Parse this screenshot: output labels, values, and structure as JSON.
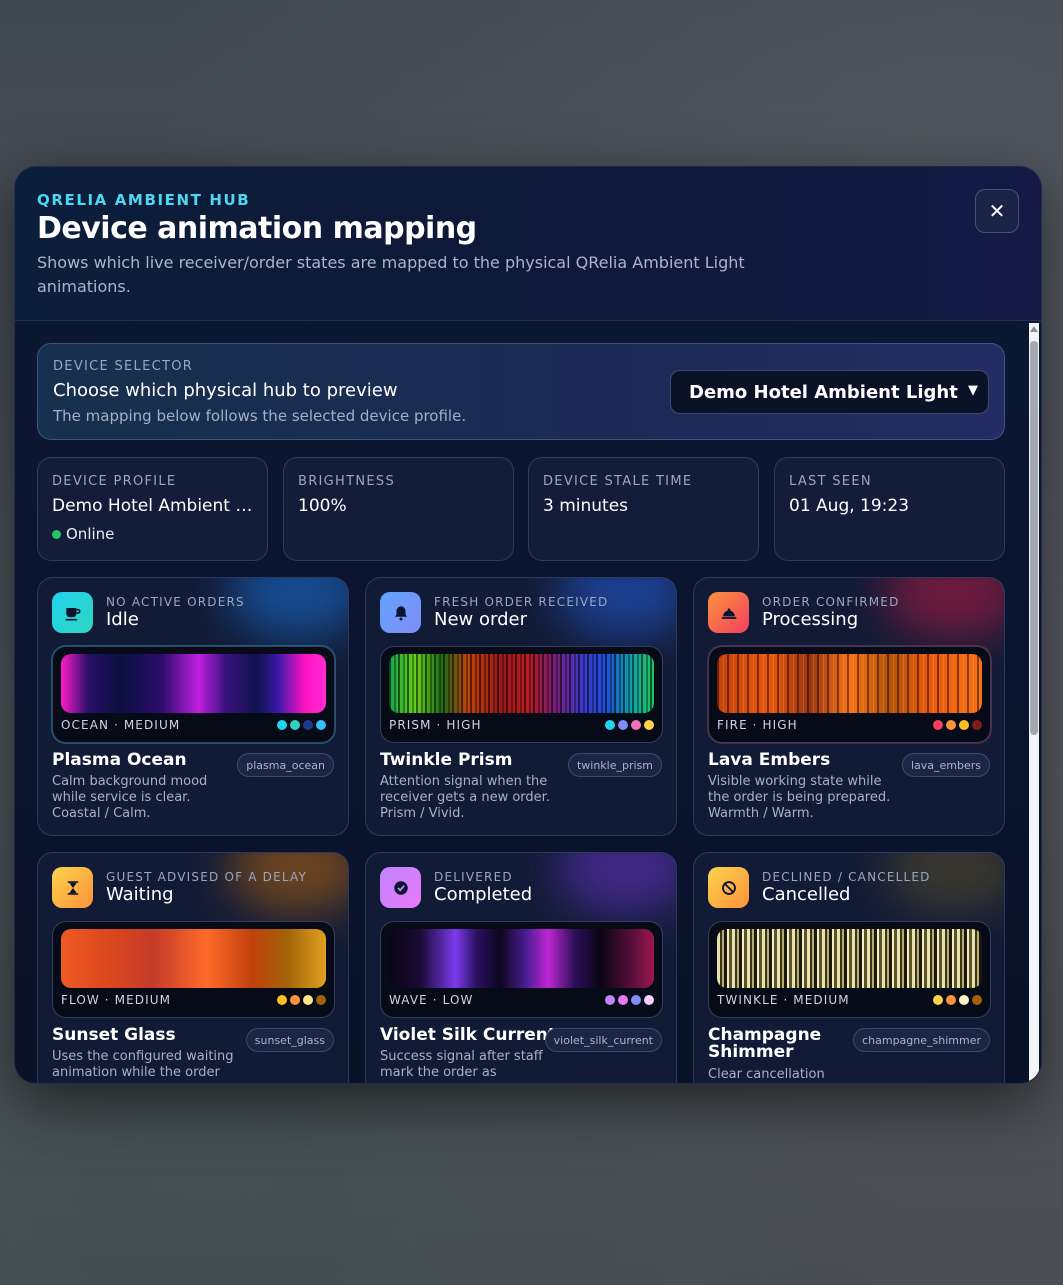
{
  "header": {
    "eyebrow": "QRELIA AMBIENT HUB",
    "title": "Device animation mapping",
    "subtitle": "Shows which live receiver/order states are mapped to the physical QRelia Ambient Light animations.",
    "close_label": "✕"
  },
  "selector": {
    "eyebrow": "DEVICE SELECTOR",
    "title": "Choose which physical hub to preview",
    "help": "The mapping below follows the selected device profile.",
    "selected": "Demo Hotel Ambient Light"
  },
  "stats": [
    {
      "label": "DEVICE PROFILE",
      "value": "Demo Hotel Ambient Light",
      "status": "Online"
    },
    {
      "label": "BRIGHTNESS",
      "value": "100%"
    },
    {
      "label": "DEVICE STALE TIME",
      "value": "3 minutes"
    },
    {
      "label": "LAST SEEN",
      "value": "01 Aug, 19:23"
    }
  ],
  "cards": [
    {
      "state": "NO ACTIVE ORDERS",
      "name": "Idle",
      "icon": "coffee-cup-icon",
      "mode": "OCEAN · MEDIUM",
      "animation": "Plasma Ocean",
      "tag": "plasma_ocean",
      "description": "Calm background mood while service is clear. Coastal / Calm.",
      "swatches": [
        "#22d3ee",
        "#2dd4bf",
        "#1e3a8a",
        "#38bdf8"
      ]
    },
    {
      "state": "FRESH ORDER RECEIVED",
      "name": "New order",
      "icon": "bell-icon",
      "mode": "PRISM · HIGH",
      "animation": "Twinkle Prism",
      "tag": "twinkle_prism",
      "description": "Attention signal when the receiver gets a new order. Prism / Vivid.",
      "swatches": [
        "#22d3ee",
        "#818cf8",
        "#f472b6",
        "#fcd34d"
      ]
    },
    {
      "state": "ORDER CONFIRMED",
      "name": "Processing",
      "icon": "chef-icon",
      "mode": "FIRE · HIGH",
      "animation": "Lava Embers",
      "tag": "lava_embers",
      "description": "Visible working state while the order is being prepared. Warmth / Warm.",
      "swatches": [
        "#f43f5e",
        "#fb923c",
        "#fbbf24",
        "#7f1d1d"
      ]
    },
    {
      "state": "GUEST ADVISED OF A DELAY",
      "name": "Waiting",
      "icon": "hourglass-icon",
      "mode": "FLOW · MEDIUM",
      "animation": "Sunset Glass",
      "tag": "sunset_glass",
      "description": "Uses the configured waiting animation while the order",
      "swatches": [
        "#fbbf24",
        "#fb923c",
        "#fde68a",
        "#a16207"
      ]
    },
    {
      "state": "DELIVERED",
      "name": "Completed",
      "icon": "check-circle-icon",
      "mode": "WAVE · LOW",
      "animation": "Violet Silk Current",
      "tag": "violet_silk_current",
      "description": "Success signal after staff mark the order as",
      "swatches": [
        "#c084fc",
        "#e879f9",
        "#818cf8",
        "#f5d0fe"
      ]
    },
    {
      "state": "DECLINED / CANCELLED",
      "name": "Cancelled",
      "icon": "ban-icon",
      "mode": "TWINKLE · MEDIUM",
      "animation": "Champagne Shimmer",
      "tag": "champagne_shimmer",
      "description": "Clear cancellation",
      "swatches": [
        "#fcd34d",
        "#fb923c",
        "#fef3c7",
        "#a16207"
      ]
    }
  ]
}
